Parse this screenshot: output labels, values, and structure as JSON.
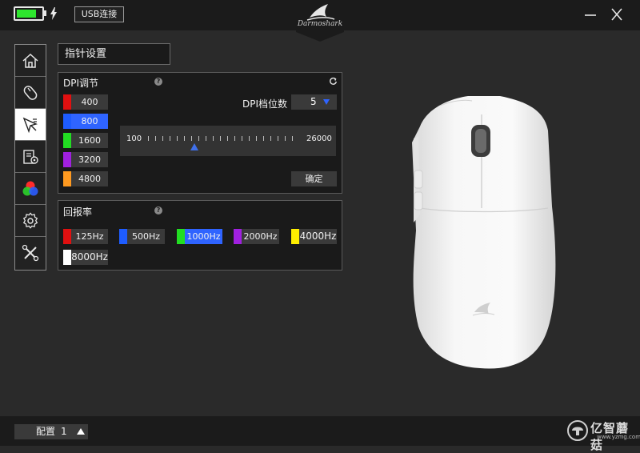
{
  "header": {
    "battery_level": 0.8,
    "battery_color": "#2ee62e",
    "usb_label": "USB连接",
    "brand": "Darmoshark",
    "minimize_icon": "minimize-icon",
    "close_icon": "close-icon"
  },
  "sidebar": {
    "items": [
      {
        "icon": "home-icon"
      },
      {
        "icon": "mouse-button-icon"
      },
      {
        "icon": "pointer-settings-icon",
        "active": true
      },
      {
        "icon": "macro-icon"
      },
      {
        "icon": "rgb-lighting-icon"
      },
      {
        "icon": "settings-gear-icon"
      },
      {
        "icon": "tools-icon"
      }
    ]
  },
  "section_title": "指针设置",
  "dpi": {
    "title": "DPI调节",
    "help": "?",
    "levels": [
      {
        "value": "400",
        "color": "#e01010"
      },
      {
        "value": "800",
        "color": "#1e5cff",
        "selected": true
      },
      {
        "value": "1600",
        "color": "#22dd22"
      },
      {
        "value": "3200",
        "color": "#a020e0"
      },
      {
        "value": "4800",
        "color": "#ff9a20"
      }
    ],
    "level_count_label": "DPI档位数",
    "level_count": "5",
    "slider_min": "100",
    "slider_max": "26000",
    "slider_value": 800,
    "confirm_label": "确定"
  },
  "report_rate": {
    "title": "回报率",
    "help": "?",
    "options": [
      {
        "value": "125Hz",
        "color": "#e01010"
      },
      {
        "value": "500Hz",
        "color": "#1e5cff"
      },
      {
        "value": "1000Hz",
        "color": "#22dd22",
        "selected": true
      },
      {
        "value": "2000Hz",
        "color": "#a020e0"
      },
      {
        "value": "4000Hz",
        "color": "#ffee00"
      },
      {
        "value": "8000Hz",
        "color": "#ffffff"
      }
    ]
  },
  "footer": {
    "profile_label": "配置",
    "profile_number": "1",
    "watermark": "亿智蘑菇",
    "watermark_url": "www.yzmg.com"
  }
}
